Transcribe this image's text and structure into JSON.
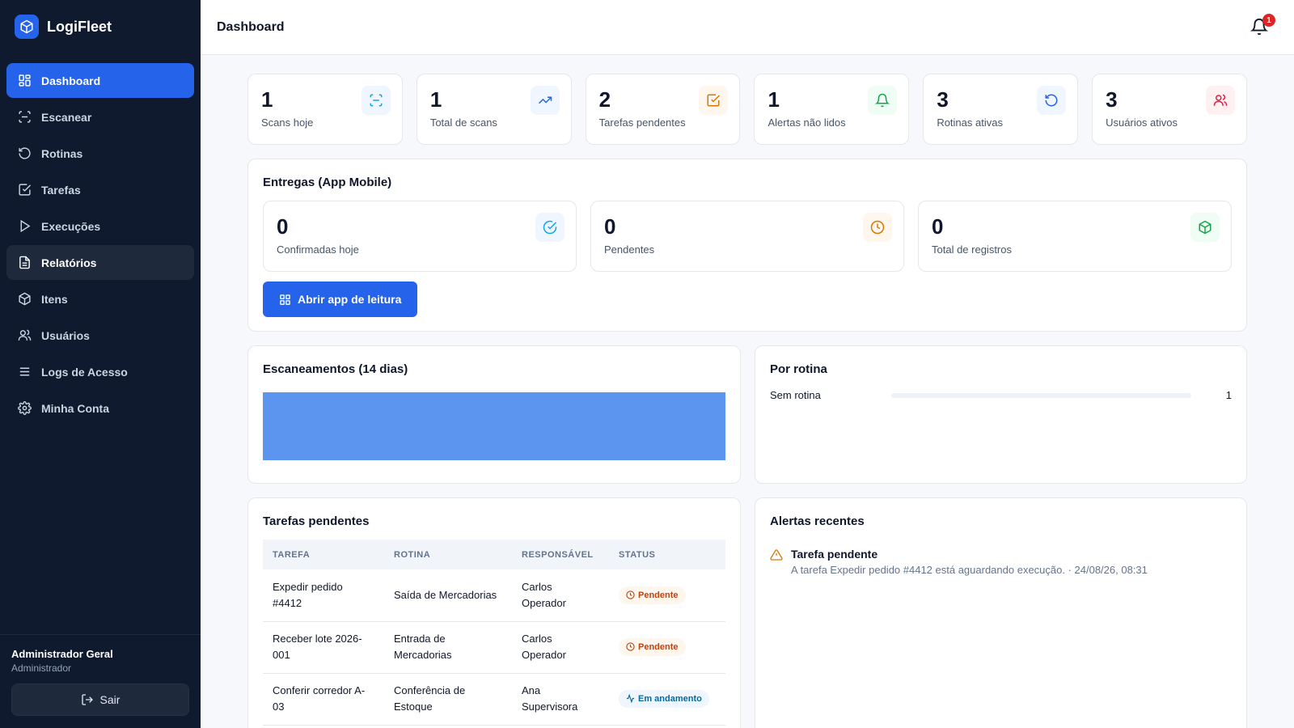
{
  "app": {
    "name": "LogiFleet"
  },
  "header": {
    "title": "Dashboard",
    "notification_count": "1"
  },
  "sidebar": {
    "items": [
      {
        "label": "Dashboard",
        "icon": "grid-icon"
      },
      {
        "label": "Escanear",
        "icon": "scan-icon"
      },
      {
        "label": "Rotinas",
        "icon": "rotate-icon"
      },
      {
        "label": "Tarefas",
        "icon": "checkbox-icon"
      },
      {
        "label": "Execuções",
        "icon": "play-icon"
      },
      {
        "label": "Relatórios",
        "icon": "file-icon"
      },
      {
        "label": "Itens",
        "icon": "box-icon"
      },
      {
        "label": "Usuários",
        "icon": "users-icon"
      },
      {
        "label": "Logs de Acesso",
        "icon": "list-icon"
      },
      {
        "label": "Minha Conta",
        "icon": "gear-icon"
      }
    ],
    "user": {
      "name": "Administrador Geral",
      "role": "Administrador"
    },
    "logout_label": "Sair"
  },
  "stats": [
    {
      "value": "1",
      "label": "Scans hoje",
      "icon": "scan-icon",
      "color": "#0ea5e9",
      "bg": "#eff6ff"
    },
    {
      "value": "1",
      "label": "Total de scans",
      "icon": "trending-up-icon",
      "color": "#2563eb",
      "bg": "#eff6ff"
    },
    {
      "value": "2",
      "label": "Tarefas pendentes",
      "icon": "checkbox-icon",
      "color": "#d97706",
      "bg": "#fff7ed"
    },
    {
      "value": "1",
      "label": "Alertas não lidos",
      "icon": "bell-icon",
      "color": "#16a34a",
      "bg": "#f0fdf4"
    },
    {
      "value": "3",
      "label": "Rotinas ativas",
      "icon": "rotate-icon",
      "color": "#2563eb",
      "bg": "#eff6ff"
    },
    {
      "value": "3",
      "label": "Usuários ativos",
      "icon": "users-icon",
      "color": "#e11d48",
      "bg": "#fff1f2"
    }
  ],
  "deliveries": {
    "title": "Entregas (App Mobile)",
    "cards": [
      {
        "value": "0",
        "label": "Confirmadas hoje",
        "icon": "check-circle-icon",
        "color": "#0ea5e9",
        "bg": "#eff6ff"
      },
      {
        "value": "0",
        "label": "Pendentes",
        "icon": "clock-icon",
        "color": "#d97706",
        "bg": "#fff7ed"
      },
      {
        "value": "0",
        "label": "Total de registros",
        "icon": "box-icon",
        "color": "#16a34a",
        "bg": "#f0fdf4"
      }
    ],
    "button_label": "Abrir app de leitura"
  },
  "scans_chart": {
    "title": "Escaneamentos (14 dias)",
    "bar_color": "#5b95f0"
  },
  "chart_data": {
    "type": "bar",
    "title": "Escaneamentos (14 dias)",
    "categories": [
      ""
    ],
    "values": [
      1
    ],
    "ylim": [
      0,
      1
    ]
  },
  "routines": {
    "title": "Por rotina",
    "items": [
      {
        "name": "Sem rotina",
        "count": "1",
        "fraction": 0
      }
    ]
  },
  "tasks": {
    "title": "Tarefas pendentes",
    "columns": [
      "TAREFA",
      "ROTINA",
      "RESPONSÁVEL",
      "STATUS"
    ],
    "rows": [
      {
        "task": "Expedir pedido #4412",
        "routine": "Saída de Mercadorias",
        "owner": "Carlos Operador",
        "status": "Pendente",
        "status_type": "pending"
      },
      {
        "task": "Receber lote 2026-001",
        "routine": "Entrada de Mercadorias",
        "owner": "Carlos Operador",
        "status": "Pendente",
        "status_type": "pending"
      },
      {
        "task": "Conferir corredor A-03",
        "routine": "Conferência de Estoque",
        "owner": "Ana Supervisora",
        "status": "Em andamento",
        "status_type": "progress"
      }
    ]
  },
  "alerts": {
    "title": "Alertas recentes",
    "items": [
      {
        "title": "Tarefa pendente",
        "text": "A tarefa Expedir pedido #4412 está aguardando execução. · 24/08/26, 08:31",
        "icon": "warning-icon",
        "color": "#d97706"
      }
    ]
  }
}
